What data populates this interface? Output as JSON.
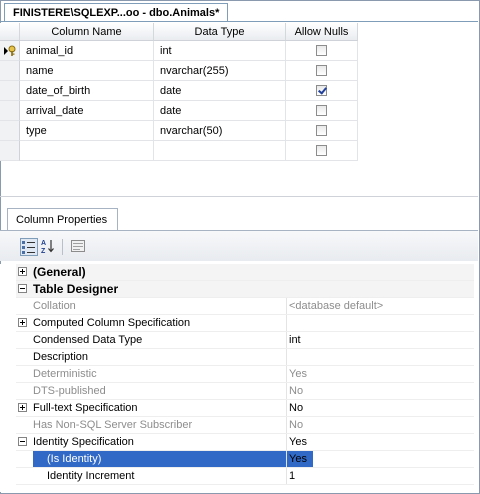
{
  "document_tab": {
    "title": "FINISTERE\\SQLEXP...oo - dbo.Animals*"
  },
  "designer": {
    "headers": {
      "column_name": "Column Name",
      "data_type": "Data Type",
      "allow_nulls": "Allow Nulls"
    },
    "rows": [
      {
        "name": "animal_id",
        "type": "int",
        "allow_nulls": false,
        "primary_key": true
      },
      {
        "name": "name",
        "type": "nvarchar(255)",
        "allow_nulls": false
      },
      {
        "name": "date_of_birth",
        "type": "date",
        "allow_nulls": true
      },
      {
        "name": "arrival_date",
        "type": "date",
        "allow_nulls": false
      },
      {
        "name": "type",
        "type": "nvarchar(50)",
        "allow_nulls": false
      },
      {
        "name": "",
        "type": "",
        "allow_nulls": false
      }
    ]
  },
  "properties": {
    "tab_label": "Column Properties",
    "toolbar": {
      "categorized_icon": "categorized-icon",
      "alphabetical_icon": "alphabetical-sort-icon",
      "pages_icon": "property-pages-icon"
    },
    "rows": [
      {
        "name": "(General)",
        "value": "",
        "kind": "category",
        "expander": "plus"
      },
      {
        "name": "Table Designer",
        "value": "",
        "kind": "category",
        "expander": "minus"
      },
      {
        "name": "Collation",
        "value": "<database default>",
        "kind": "disabled"
      },
      {
        "name": "Computed Column Specification",
        "value": "",
        "kind": "normal",
        "expander": "plus"
      },
      {
        "name": "Condensed Data Type",
        "value": "int",
        "kind": "normal"
      },
      {
        "name": "Description",
        "value": "",
        "kind": "normal"
      },
      {
        "name": "Deterministic",
        "value": "Yes",
        "kind": "disabled"
      },
      {
        "name": "DTS-published",
        "value": "No",
        "kind": "disabled"
      },
      {
        "name": "Full-text Specification",
        "value": "No",
        "kind": "normal",
        "expander": "plus"
      },
      {
        "name": "Has Non-SQL Server Subscriber",
        "value": "No",
        "kind": "disabled"
      },
      {
        "name": "Identity Specification",
        "value": "Yes",
        "kind": "normal",
        "expander": "minus"
      },
      {
        "name": "(Is Identity)",
        "value": "Yes",
        "kind": "selected-sub"
      },
      {
        "name": "Identity Increment",
        "value": "1",
        "kind": "sub"
      }
    ]
  }
}
